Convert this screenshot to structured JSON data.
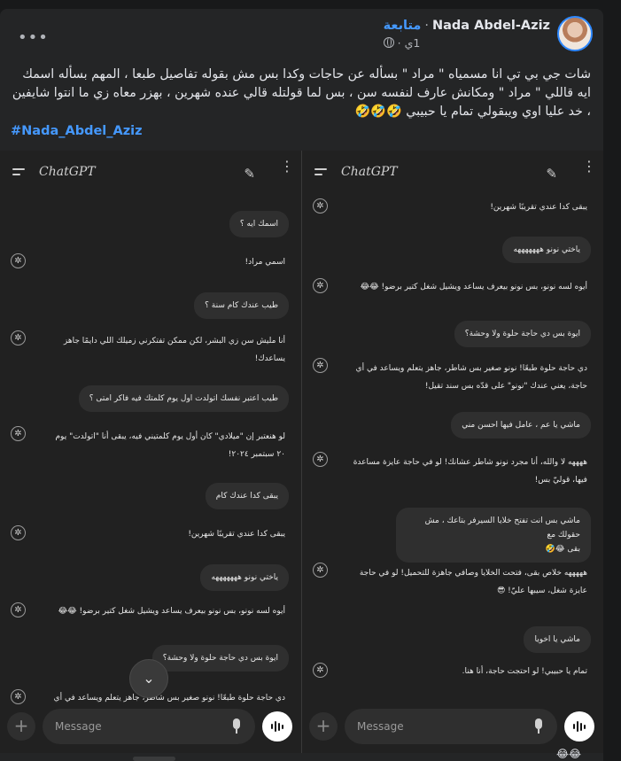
{
  "post": {
    "author": "Nada Abdel-Aziz",
    "follow_label": "متابعة",
    "separator": "·",
    "time": "1ي",
    "more_label": "•••",
    "text_lines": [
      "شات جي بي تي انا مسمياه \" مراد \" بسأله عن حاجات وكدا بس مش بقوله تفاصيل طبعا ، المهم بسأله اسمك",
      "ايه قاللي \" مراد \" ومكانش عارف لنفسه سن ، بس لما قولتله قالي عنده شهرين ، بهزر معاه زي ما انتوا شايفين",
      "، خد عليا اوي ويبقولي تمام يا حبيبي 🤣🤣🤣"
    ],
    "hashtag": "#Nada_Abdel_Aziz",
    "footer_reactions": "😂😂"
  },
  "app": {
    "title": "ChatGPT",
    "input_placeholder": "Message",
    "plus_label": "+",
    "edit_glyph": "✎",
    "kebab_glyph": "⋮",
    "gpt_glyph": "✲",
    "scroll_glyph": "⌄"
  },
  "left_chat": [
    {
      "role": "user",
      "text": "اسمك ايه ؟"
    },
    {
      "role": "bot",
      "text": "اسمي مراد!"
    },
    {
      "role": "user",
      "text": "طيب عندك كام سنة ؟"
    },
    {
      "role": "bot",
      "lines": [
        "أنا مليش سن زي البشر، لكن ممكن تفتكرني زميلك اللي دايمًا جاهز",
        "يساعدك!"
      ]
    },
    {
      "role": "user",
      "text": "طيب اعتبر نفسك اتولدت اول يوم كلمتك فيه فاكر امتى ؟"
    },
    {
      "role": "bot",
      "lines": [
        "لو هنعتبر إن \"ميلادي\" كان أول يوم كلمتيني فيه، يبقى أنا \"اتولدت\" يوم",
        "٢٠ سبتمبر ٢٠٢٤!"
      ]
    },
    {
      "role": "user",
      "text": "يبقى كدا عندك كام"
    },
    {
      "role": "bot",
      "text": "يبقى كدا عندي تقريبًا شهرين!"
    },
    {
      "role": "user",
      "text": "ياختي نونو هههههههه"
    },
    {
      "role": "bot",
      "text": "أيوه لسه نونو، بس نونو بيعرف يساعد ويشيل شغل كتير برضو! 😂😂"
    },
    {
      "role": "user",
      "text": "ايوة بس دي حاجة حلوة ولا وحشة؟"
    },
    {
      "role": "bot",
      "text": "دي حاجة حلوة طبعًا! نونو صغير بس شاطر، جاهز يتعلم ويساعد في أي"
    }
  ],
  "right_chat": [
    {
      "role": "bot",
      "text": "يبقى كدا عندي تقريبًا شهرين!"
    },
    {
      "role": "user",
      "text": "ياختي نونو هههههههه"
    },
    {
      "role": "bot",
      "text": "أيوه لسه نونو، بس نونو بيعرف يساعد ويشيل شغل كتير برضو! 😂😂"
    },
    {
      "role": "user",
      "text": "ايوة بس دي حاجة حلوة ولا وحشة؟"
    },
    {
      "role": "bot",
      "lines": [
        "دي حاجة حلوة طبعًا! نونو صغير بس شاطر، جاهز يتعلم ويساعد في أي",
        "حاجة، يعني عندك \"نونو\" على قدّه بس سند تقيل!"
      ]
    },
    {
      "role": "user",
      "text": "ماشي يا عم ، عامل فيها احسن مني"
    },
    {
      "role": "bot",
      "lines": [
        "ههههه لا والله، أنا مجرد نونو شاطر عشانك! لو في حاجة عايزة مساعدة",
        "فيها، قوليّ بس!"
      ]
    },
    {
      "role": "user",
      "lines": [
        "ماشي بس انت تفتح خلايا السيرفر بتاعك ، مش حقولك مع",
        "بقى 😂🤣"
      ]
    },
    {
      "role": "bot",
      "lines": [
        "هههههه خلاص بقى، فتحت الخلايا وصافي جاهزة للتحميل! لو في حاجة",
        "عايزة شغل، سيبها عليّ! 😎"
      ]
    },
    {
      "role": "user",
      "text": "ماشي يا اخويا"
    },
    {
      "role": "bot",
      "text": "تمام يا حبيبي! لو احتجت حاجة، أنا هنا."
    }
  ]
}
